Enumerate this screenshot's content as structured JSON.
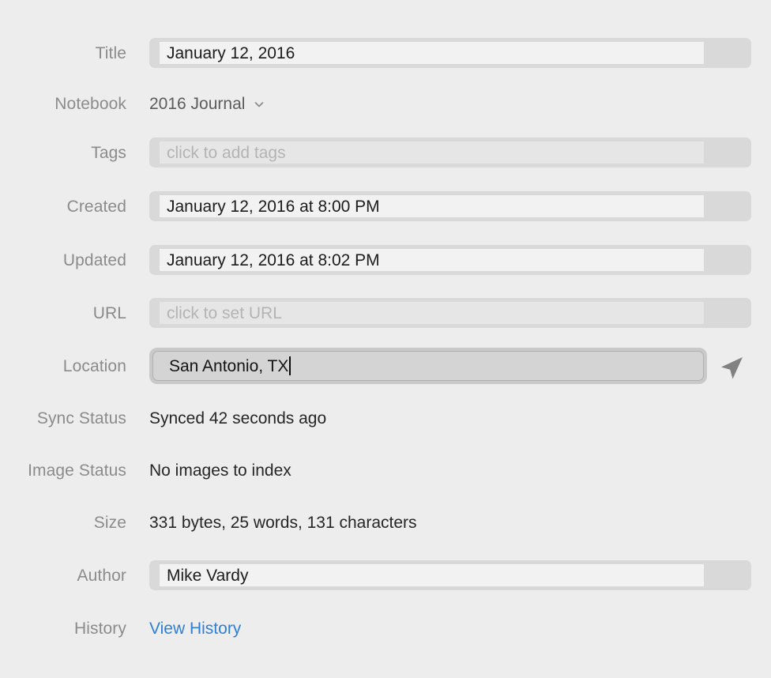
{
  "inspector": {
    "rows": [
      {
        "key": "title",
        "label": "Title",
        "kind": "field",
        "value": "January 12, 2016",
        "placeholder": ""
      },
      {
        "key": "notebook",
        "label": "Notebook",
        "kind": "popup",
        "value": "2016 Journal",
        "icon": "chevron-down-icon"
      },
      {
        "key": "tags",
        "label": "Tags",
        "kind": "field",
        "value": "",
        "placeholder": "click to add tags"
      },
      {
        "key": "created",
        "label": "Created",
        "kind": "field",
        "value": "January 12, 2016 at 8:00 PM",
        "placeholder": ""
      },
      {
        "key": "updated",
        "label": "Updated",
        "kind": "field",
        "value": "January 12, 2016 at 8:02 PM",
        "placeholder": ""
      },
      {
        "key": "url",
        "label": "URL",
        "kind": "field",
        "value": "",
        "placeholder": "click to set URL"
      },
      {
        "key": "location",
        "label": "Location",
        "kind": "field-focused",
        "value": "San Antonio, TX",
        "placeholder": "",
        "accessory_icon": "location-arrow-icon"
      },
      {
        "key": "sync_status",
        "label": "Sync Status",
        "kind": "static",
        "value": "Synced 42 seconds ago"
      },
      {
        "key": "image_status",
        "label": "Image Status",
        "kind": "static",
        "value": "No images to index"
      },
      {
        "key": "size",
        "label": "Size",
        "kind": "static",
        "value": "331 bytes, 25 words, 131 characters"
      },
      {
        "key": "author",
        "label": "Author",
        "kind": "field",
        "value": "Mike Vardy",
        "placeholder": ""
      },
      {
        "key": "history",
        "label": "History",
        "kind": "link",
        "value": "View History"
      }
    ]
  },
  "colors": {
    "background": "#ededed",
    "label": "#8b8b8b",
    "value": "#262626",
    "placeholder": "#b4b4b4",
    "field_fill": "#d9d9d9",
    "field_inner": "#f2f2f2",
    "link": "#2e7fd4",
    "icon": "#808080"
  }
}
